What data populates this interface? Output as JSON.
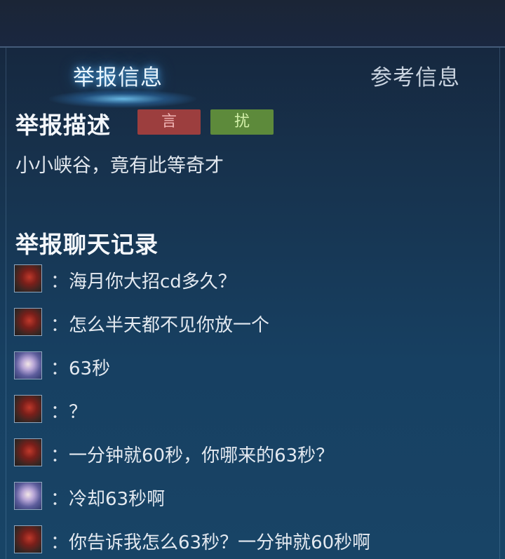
{
  "tabs": {
    "active": "举报信息",
    "inactive": "参考信息"
  },
  "report_description": {
    "title": "举报描述",
    "badges": [
      {
        "label": "言",
        "color": "#9c3e3e"
      },
      {
        "label": "扰",
        "color": "#5d8a3b"
      }
    ],
    "text": "小小峡谷，竟有此等奇才"
  },
  "chat_log": {
    "title": "举报聊天记录",
    "messages": [
      {
        "avatar": "red-hero-avatar",
        "colon": "：",
        "text": "海月你大招cd多久？"
      },
      {
        "avatar": "red-hero-avatar",
        "colon": "：",
        "text": "怎么半天都不见你放一个"
      },
      {
        "avatar": "blue-hero-avatar",
        "colon": "：",
        "text": "63秒"
      },
      {
        "avatar": "red-hero-avatar",
        "colon": "：",
        "text": "？"
      },
      {
        "avatar": "red-hero-avatar",
        "colon": "：",
        "text": "一分钟就60秒，你哪来的63秒？"
      },
      {
        "avatar": "blue-hero-avatar",
        "colon": "：",
        "text": "冷却63秒啊"
      },
      {
        "avatar": "red-hero-avatar",
        "colon": "：",
        "text": "你告诉我怎么63秒？一分钟就60秒啊"
      }
    ]
  }
}
